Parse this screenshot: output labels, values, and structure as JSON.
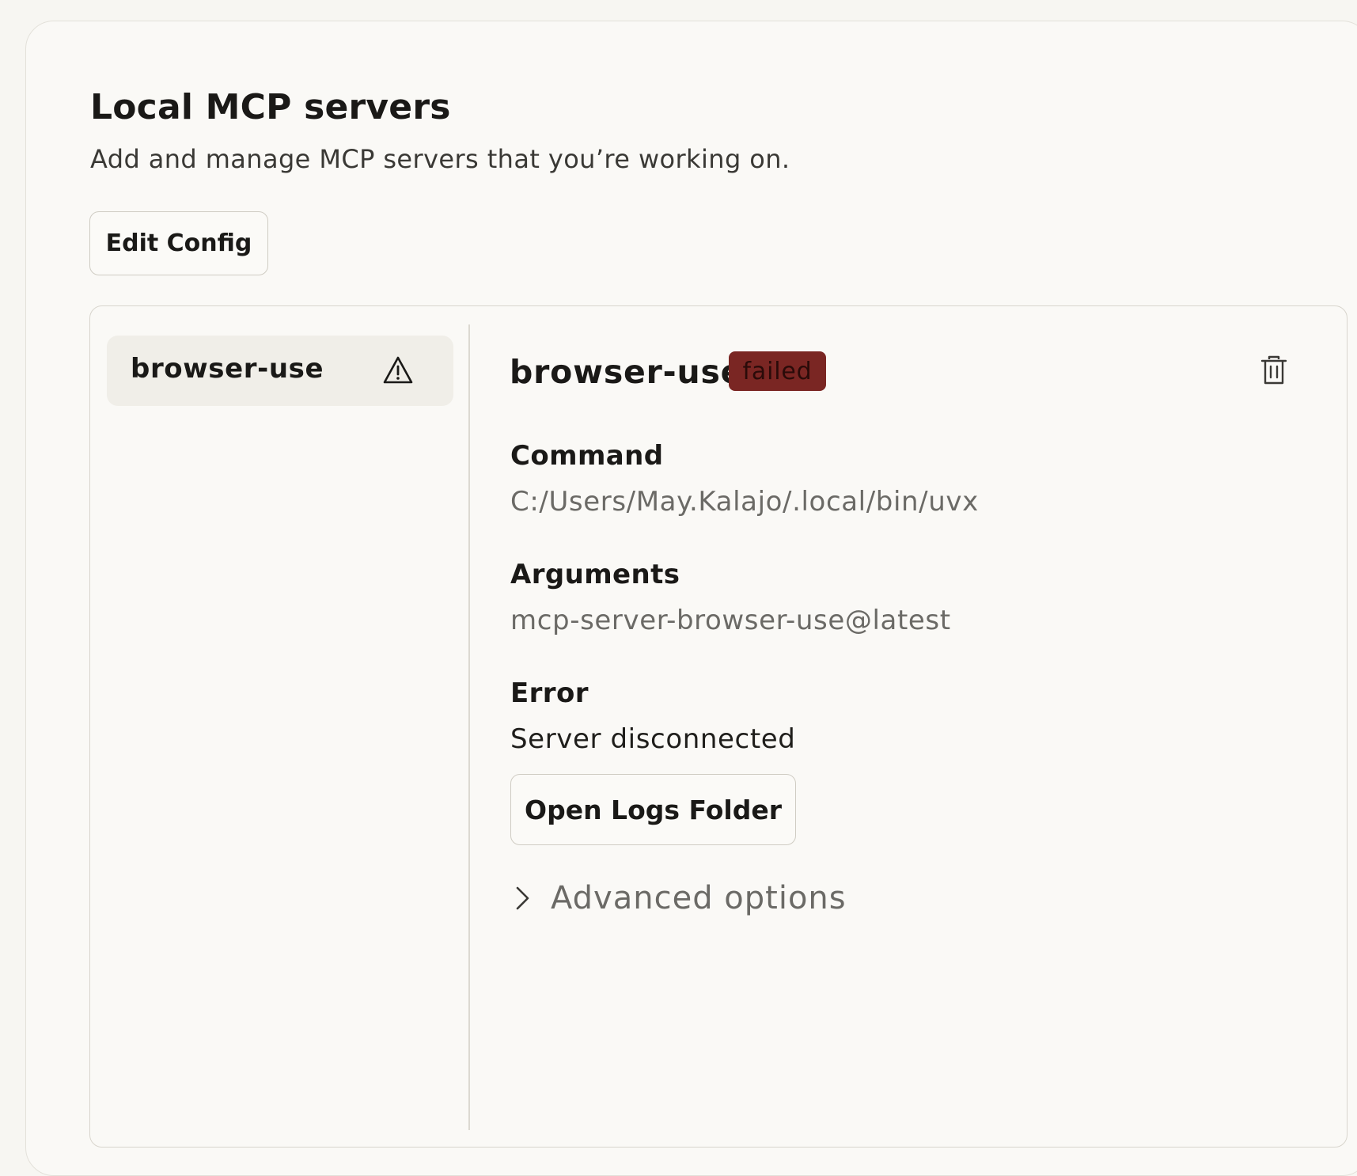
{
  "page": {
    "title": "Local MCP servers",
    "subtitle": "Add and manage MCP servers that you’re working on.",
    "edit_config_label": "Edit Config"
  },
  "sidebar": {
    "items": [
      {
        "label": "browser-use",
        "icon": "warning-triangle-icon",
        "selected": true
      }
    ]
  },
  "detail": {
    "title": "browser-use",
    "status": "failed",
    "status_color": "#7a2623",
    "delete_icon": "trash-icon",
    "command_label": "Command",
    "command_value": "C:/Users/May.Kalajo/.local/bin/uvx",
    "arguments_label": "Arguments",
    "arguments_value": "mcp-server-browser-use@latest",
    "error_label": "Error",
    "error_value": "Server disconnected",
    "open_logs_label": "Open Logs Folder",
    "advanced_label": "Advanced options",
    "advanced_icon": "chevron-right-icon"
  }
}
